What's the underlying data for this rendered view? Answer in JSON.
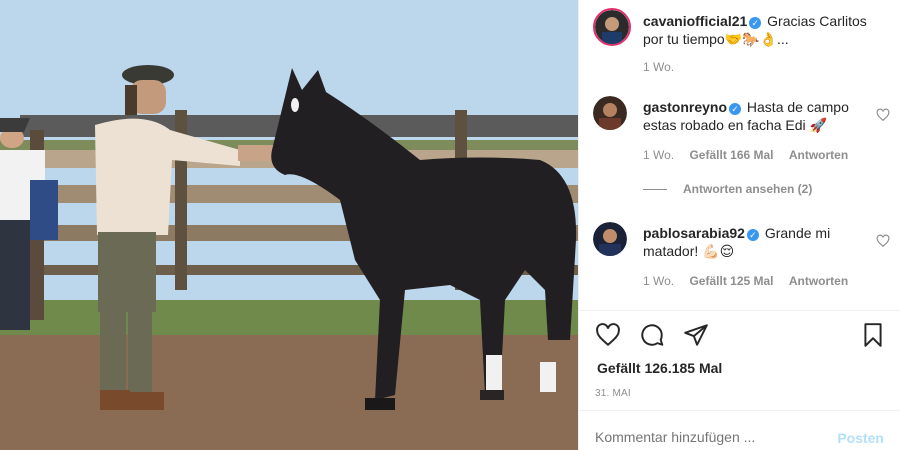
{
  "post": {
    "author": "cavaniofficial21",
    "caption": "Gracias Carlitos por tu tiempo🤝🐎👌...",
    "time": "1 Wo."
  },
  "comments": [
    {
      "user": "gastonreyno",
      "text": "Hasta de campo estas robado en facha Edi 🚀",
      "time": "1 Wo.",
      "likes": "Gefällt 166 Mal",
      "reply": "Antworten"
    },
    {
      "user": "pablosarabia92",
      "text": "Grande mi matador! 💪🏻😌",
      "time": "1 Wo.",
      "likes": "Gefällt 125 Mal",
      "reply": "Antworten"
    }
  ],
  "view_replies": "Antworten ansehen (2)",
  "likes_total": "Gefällt 126.185 Mal",
  "date": "31. MAI",
  "comment_input": {
    "placeholder": "Kommentar hinzufügen ..."
  },
  "post_button": "Posten",
  "verified_mark": "✓",
  "icons": [
    "heart-icon",
    "comment-icon",
    "share-icon",
    "bookmark-icon"
  ],
  "colors": {
    "verified": "#3897f0",
    "post_button": "#b2dffc",
    "muted": "#8e8e8e"
  }
}
